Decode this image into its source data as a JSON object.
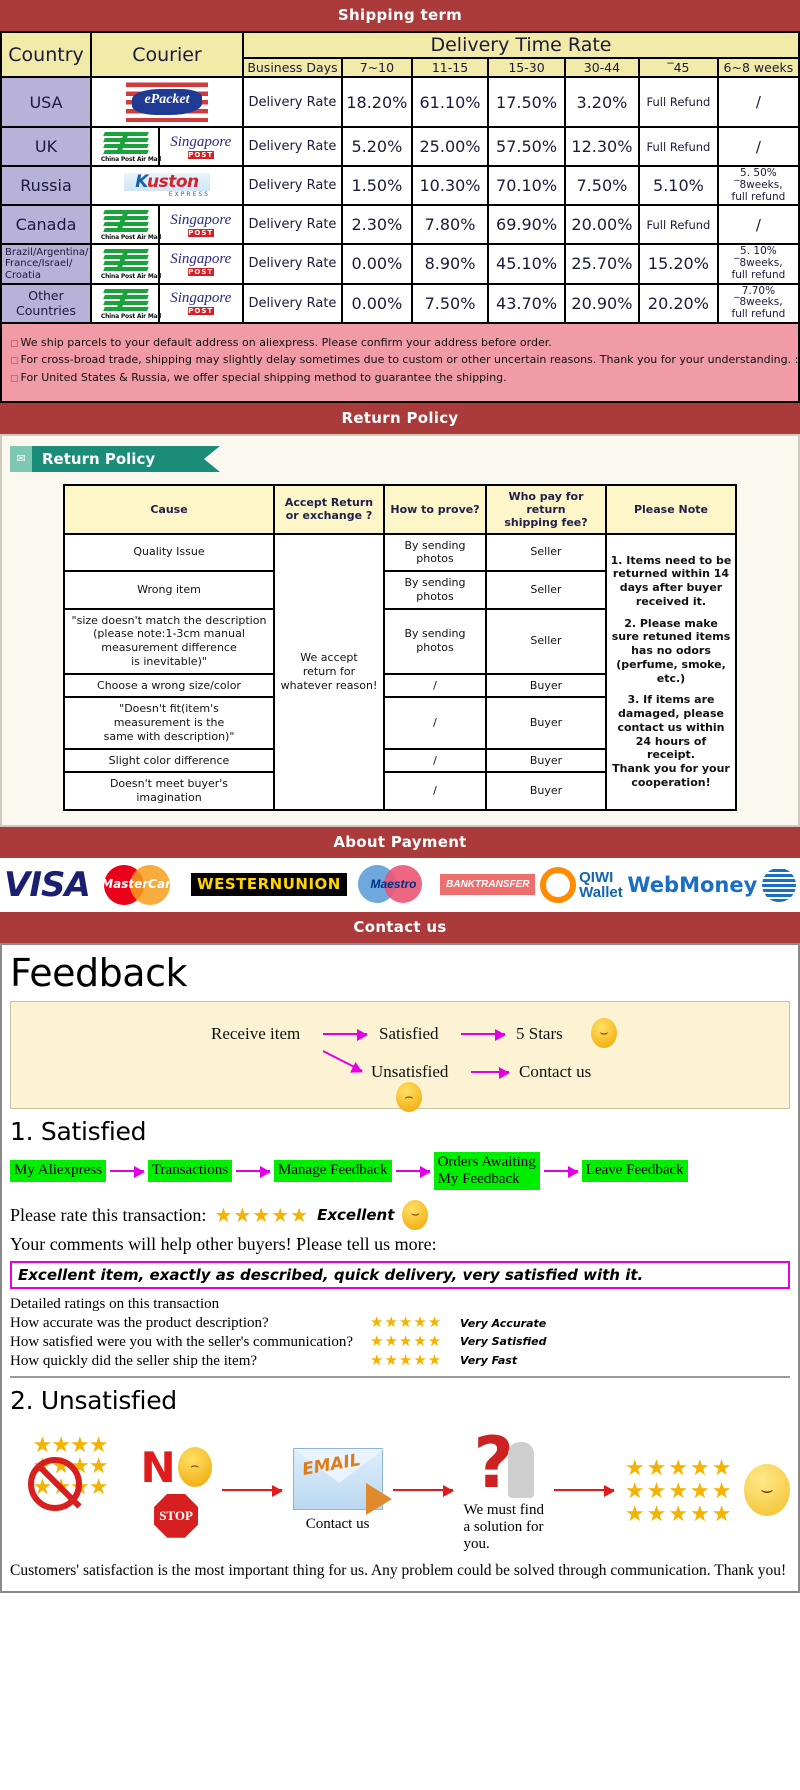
{
  "banners": {
    "shipping": "Shipping term",
    "return": "Return Policy",
    "payment": "About Payment",
    "contact": "Contact us"
  },
  "shipping_table": {
    "headers": {
      "country": "Country",
      "courier": "Courier",
      "delivery_time_rate": "Delivery Time Rate",
      "business_days": "Business Days",
      "buckets": [
        "7~10",
        "11-15",
        "15-30",
        "30-44",
        "‾45",
        "6~8 weeks"
      ]
    },
    "rows": [
      {
        "country": "USA",
        "couriers": [
          "epacket"
        ],
        "label": "Delivery Rate",
        "values": [
          "18.20%",
          "61.10%",
          "17.50%",
          "3.20%",
          "Full Refund",
          "/"
        ]
      },
      {
        "country": "UK",
        "couriers": [
          "china-post-air-mail",
          "singapore-post"
        ],
        "label": "Delivery Rate",
        "values": [
          "5.20%",
          "25.00%",
          "57.50%",
          "12.30%",
          "Full Refund",
          "/"
        ]
      },
      {
        "country": "Russia",
        "couriers": [
          "kuston-express"
        ],
        "label": "Delivery Rate",
        "values": [
          "1.50%",
          "10.30%",
          "70.10%",
          "7.50%",
          "5.10%",
          "5. 50%\n‾8weeks,\nfull refund"
        ]
      },
      {
        "country": "Canada",
        "couriers": [
          "china-post-air-mail",
          "singapore-post"
        ],
        "label": "Delivery Rate",
        "values": [
          "2.30%",
          "7.80%",
          "69.90%",
          "20.00%",
          "Full Refund",
          "/"
        ]
      },
      {
        "country": "Brazil/Argentina/\nFrance/Israel/\nCroatia",
        "couriers": [
          "china-post-air-mail",
          "singapore-post"
        ],
        "label": "Delivery Rate",
        "values": [
          "0.00%",
          "8.90%",
          "45.10%",
          "25.70%",
          "15.20%",
          "5. 10%\n‾8weeks,\nfull refund"
        ]
      },
      {
        "country": "Other Countries",
        "couriers": [
          "china-post-air-mail",
          "singapore-post"
        ],
        "label": "Delivery Rate",
        "values": [
          "0.00%",
          "7.50%",
          "43.70%",
          "20.90%",
          "20.20%",
          "7.70%\n‾8weeks,\nfull refund"
        ]
      }
    ]
  },
  "shipping_notes": [
    "We ship parcels to your default address on aliexpress. Please confirm your address before order.",
    "For cross-broad trade, shipping may slightly delay sometimes due to custom or other uncertain reasons. Thank you for your understanding. :)",
    "For United States & Russia, we offer special shipping method to guarantee the shipping."
  ],
  "return_policy": {
    "tag_label": "Return Policy",
    "headers": [
      "Cause",
      "Accept Return\nor exchange ?",
      "How to prove?",
      "Who pay for return\nshipping fee?",
      "Please Note"
    ],
    "accept_text": "We accept\nreturn for\nwhatever reason!",
    "rows": [
      {
        "cause": "Quality Issue",
        "prove": "By sending\nphotos",
        "payer": "Seller"
      },
      {
        "cause": "Wrong item",
        "prove": "By sending\nphotos",
        "payer": "Seller"
      },
      {
        "cause": "\"size doesn't match the description\n(please note:1-3cm manual\nmeasurement difference\nis inevitable)\"",
        "prove": "By sending\nphotos",
        "payer": "Seller"
      },
      {
        "cause": "Choose a wrong size/color",
        "prove": "/",
        "payer": "Buyer"
      },
      {
        "cause": "\"Doesn't fit(item's\nmeasurement is the\nsame with description)\"",
        "prove": "/",
        "payer": "Buyer"
      },
      {
        "cause": "Slight color difference",
        "prove": "/",
        "payer": "Buyer"
      },
      {
        "cause": "Doesn't meet buyer's\nimagination",
        "prove": "/",
        "payer": "Buyer"
      }
    ],
    "notes": [
      "1. Items need to be returned within 14 days after buyer received it.",
      "2. Please make sure retuned items has no odors (perfume, smoke, etc.)",
      "3. If items are damaged, please contact us within 24 hours of receipt.\nThank you for your cooperation!"
    ]
  },
  "payment_methods": [
    {
      "name": "visa",
      "label": "VISA"
    },
    {
      "name": "mastercard",
      "label": "MasterCard"
    },
    {
      "name": "western-union",
      "line1": "WESTERN",
      "line2": "UNION"
    },
    {
      "name": "maestro",
      "label": "Maestro"
    },
    {
      "name": "bank-transfer",
      "line1": "BANK",
      "line2": "TRANSFER"
    },
    {
      "name": "qiwi-wallet",
      "line1": "QIWI",
      "line2": "Wallet"
    },
    {
      "name": "webmoney",
      "label": "WebMoney"
    }
  ],
  "feedback": {
    "title": "Feedback",
    "diagram": {
      "receive_item": "Receive item",
      "satisfied": "Satisfied",
      "five_stars": "5 Stars",
      "unsatisfied": "Unsatisfied",
      "contact_us": "Contact us"
    },
    "satisfied": {
      "heading": "1. Satisfied",
      "steps": [
        "My Aliexpress",
        "Transactions",
        "Manage Feedback",
        "Orders Awaiting\nMy Feedback",
        "Leave Feedback"
      ],
      "rate_prompt": "Please rate this transaction:",
      "rate_stars": "★★★★★",
      "rate_word": "Excellent",
      "comments_prompt": "Your comments will help other buyers! Please tell us more:",
      "comment_example": "Excellent item, exactly as described, quick delivery, very satisfied with it.",
      "detail_heading": "Detailed ratings on this transaction",
      "detail_rows": [
        {
          "question": "How accurate was the product description?",
          "stars": "★★★★★",
          "label": "Very Accurate"
        },
        {
          "question": "How satisfied were you with the seller's communication?",
          "stars": "★★★★★",
          "label": "Very Satisfied"
        },
        {
          "question": "How quickly did the seller ship the item?",
          "stars": "★★★★★",
          "label": "Very Fast"
        }
      ]
    },
    "unsatisfied": {
      "heading": "2. Unsatisfied",
      "no_label": "N",
      "stop_label": "STOP",
      "email_label": "EMAIL",
      "contact_caption": "Contact us",
      "solution_caption": "We must find\na solution for\nyou.",
      "footer": "Customers' satisfaction is the most important thing for us. Any problem could be solved through communication. Thank you!"
    }
  }
}
